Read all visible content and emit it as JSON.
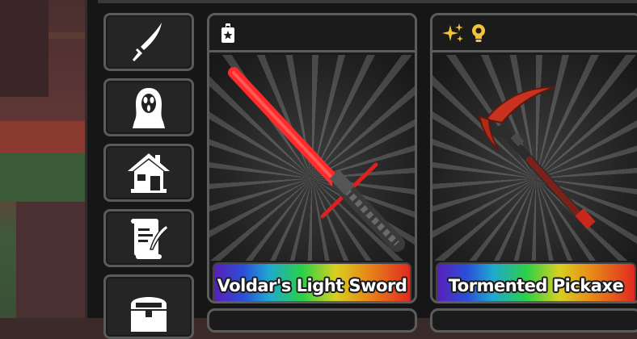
{
  "categories": [
    {
      "icon": "sword-icon"
    },
    {
      "icon": "ghostface-icon"
    },
    {
      "icon": "house-icon"
    },
    {
      "icon": "scroll-quill-icon"
    },
    {
      "icon": "treasure-chest-icon"
    }
  ],
  "items": [
    {
      "name": "Voldar's Light Sword",
      "badges": [
        "card-pass-icon"
      ]
    },
    {
      "name": "Tormented Pickaxe",
      "badges": [
        "sparkles-icon",
        "lightbulb-icon"
      ]
    }
  ],
  "colors": {
    "panel": "#161616",
    "card_border": "#5c5c5c",
    "badge_gold": "#f2c23a",
    "saber_red": "#ff2a2a"
  }
}
